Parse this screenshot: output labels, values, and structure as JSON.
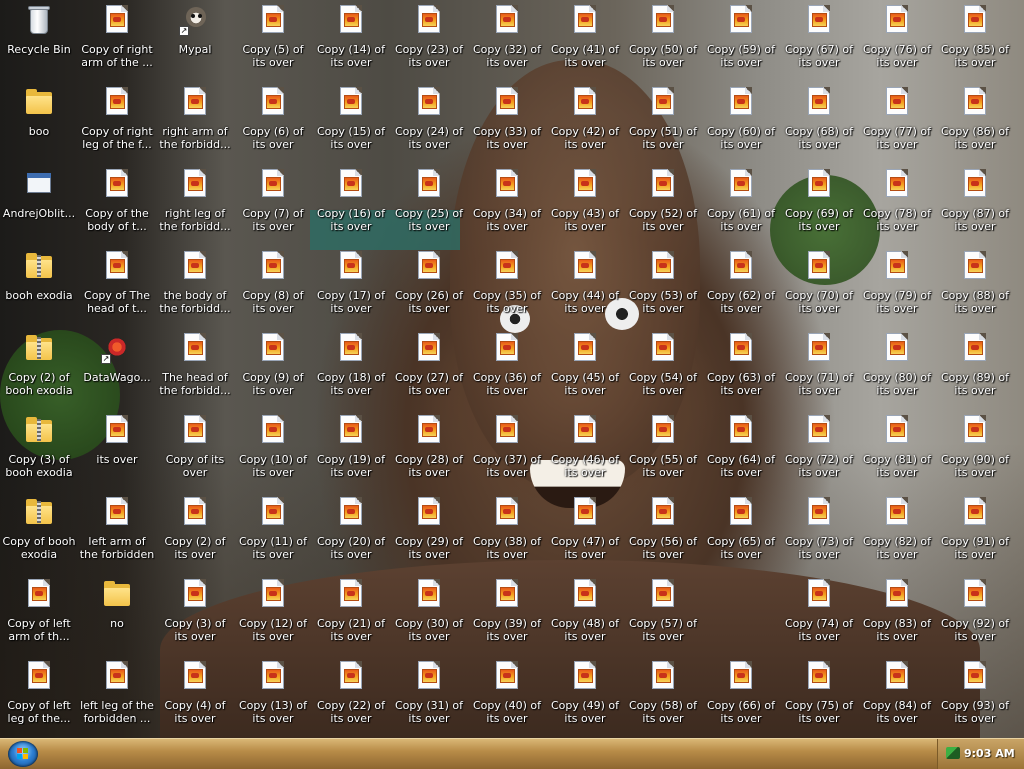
{
  "desktop": {
    "col_prefix": [
      [
        {
          "label": "Recycle Bin",
          "type": "bin"
        },
        {
          "label": "boo",
          "type": "folder"
        },
        {
          "label": "AndrejOblit...",
          "type": "app"
        },
        {
          "label": "booh exodia",
          "type": "zip"
        },
        {
          "label": "Copy (2) of booh exodia",
          "type": "zip"
        },
        {
          "label": "Copy (3) of booh exodia",
          "type": "zip"
        },
        {
          "label": "Copy of booh exodia",
          "type": "zip"
        },
        {
          "label": "Copy of left arm of th...",
          "type": "img"
        },
        {
          "label": "Copy of left leg of the...",
          "type": "img"
        }
      ],
      [
        {
          "label": "Copy of right arm of the ...",
          "type": "img"
        },
        {
          "label": "Copy of right leg of the f...",
          "type": "img"
        },
        {
          "label": "Copy of the body of t...",
          "type": "img"
        },
        {
          "label": "Copy of The head of t...",
          "type": "img"
        },
        {
          "label": "DataWago...",
          "type": "burst",
          "shortcut": true
        },
        {
          "label": "its over",
          "type": "img"
        },
        {
          "label": "left arm of the forbidden o...",
          "type": "img"
        },
        {
          "label": "no",
          "type": "folder"
        },
        {
          "label": "left leg of the forbidden ...",
          "type": "img"
        }
      ],
      [
        {
          "label": "Mypal",
          "type": "mypal",
          "shortcut": true
        },
        {
          "label": "right arm of the forbidd...",
          "type": "img"
        },
        {
          "label": "right leg of the forbidd...",
          "type": "img"
        },
        {
          "label": "the body of the forbidd...",
          "type": "img"
        },
        {
          "label": "The head of the forbidd...",
          "type": "img"
        },
        {
          "label": "Copy of its over",
          "type": "img"
        },
        {
          "label": "Copy (2) of its over",
          "type": "img"
        },
        {
          "label": "Copy (3) of its over",
          "type": "img"
        },
        {
          "label": "Copy (4) of its over",
          "type": "img"
        }
      ]
    ],
    "numbered_cols": [
      {
        "col": 3,
        "nums": [
          5,
          6,
          7,
          8,
          9,
          10,
          11,
          12,
          13
        ]
      },
      {
        "col": 4,
        "nums": [
          14,
          15,
          16,
          17,
          18,
          19,
          20,
          21,
          22
        ]
      },
      {
        "col": 5,
        "nums": [
          23,
          24,
          25,
          26,
          27,
          28,
          29,
          30,
          31
        ]
      },
      {
        "col": 6,
        "nums": [
          32,
          33,
          34,
          35,
          36,
          37,
          38,
          39,
          40
        ]
      },
      {
        "col": 7,
        "nums": [
          41,
          42,
          43,
          44,
          45,
          46,
          47,
          48,
          49
        ]
      },
      {
        "col": 8,
        "nums": [
          50,
          51,
          52,
          53,
          54,
          55,
          56,
          57,
          58
        ]
      },
      {
        "col": 9,
        "nums": [
          59,
          60,
          61,
          62,
          63,
          64,
          65,
          null,
          66
        ]
      },
      {
        "col": 10,
        "nums": [
          67,
          68,
          69,
          70,
          71,
          72,
          73,
          74,
          75
        ]
      },
      {
        "col": 11,
        "nums": [
          76,
          77,
          78,
          79,
          80,
          81,
          82,
          83,
          84
        ]
      },
      {
        "col": 12,
        "nums": [
          85,
          86,
          87,
          88,
          89,
          90,
          91,
          92,
          93
        ]
      }
    ],
    "numbered_label_template": "Copy ({n}) of its over"
  },
  "taskbar": {
    "start_label": "Start",
    "clock": "9:03 AM",
    "tray_icon": "network-icon"
  },
  "colors": {
    "taskbar": "#b88c48",
    "label_text": "#ffffff"
  }
}
